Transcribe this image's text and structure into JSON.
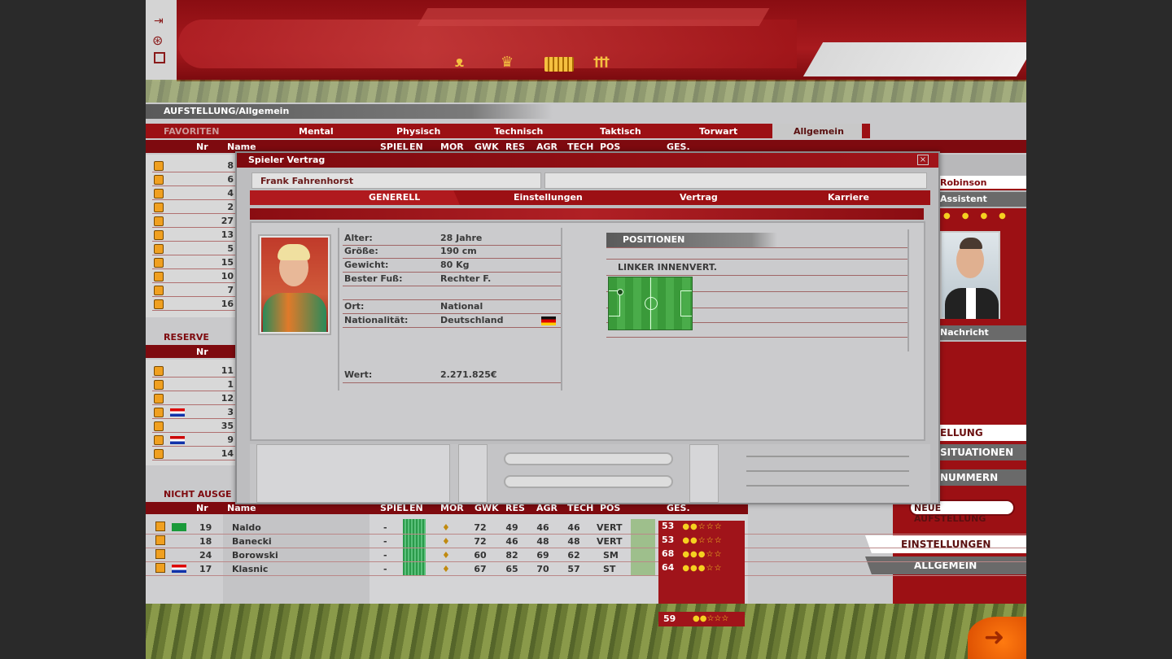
{
  "header": {
    "breadcrumb": "AUFSTELLUNG/Allgemein",
    "icons": [
      "team-icon",
      "trophy-icon",
      "stadium-icon",
      "players-icon"
    ]
  },
  "filter_tabs": {
    "favoriten": "FAVORITEN",
    "tabs": [
      "Mental",
      "Physisch",
      "Technisch",
      "Taktisch",
      "Torwart",
      "Allgemein"
    ]
  },
  "columns": {
    "nr": "Nr",
    "name": "Name",
    "headers": [
      "SPIEL",
      "EN",
      "MOR",
      "GWK",
      "RES",
      "AGR",
      "TECH",
      "POS",
      "GES."
    ]
  },
  "favoriten_numbers": [
    "8",
    "6",
    "4",
    "2",
    "27",
    "13",
    "5",
    "15",
    "10",
    "7",
    "16"
  ],
  "reserve": {
    "label": "RESERVE",
    "nr": "Nr",
    "rows": [
      "11",
      "1",
      "12",
      "3",
      "35",
      "9",
      "14"
    ]
  },
  "nicht": {
    "label": "NICHT AUSGE",
    "headers": [
      "Nr",
      "Name",
      "SPIEL",
      "EN",
      "MOR",
      "GWK",
      "RES",
      "AGR",
      "TECH",
      "POS",
      "GES."
    ],
    "rows": [
      {
        "nr": "19",
        "name": "Naldo",
        "spiel": "-",
        "gwk": "72",
        "res": "49",
        "agr": "46",
        "tech": "46",
        "pos": "VERT",
        "ges": "53"
      },
      {
        "nr": "18",
        "name": "Banecki",
        "spiel": "-",
        "gwk": "72",
        "res": "46",
        "agr": "48",
        "tech": "48",
        "pos": "VERT",
        "ges": "53"
      },
      {
        "nr": "24",
        "name": "Borowski",
        "spiel": "-",
        "gwk": "60",
        "res": "82",
        "agr": "69",
        "tech": "62",
        "pos": "SM",
        "ges": "68"
      },
      {
        "nr": "17",
        "name": "Klasnic",
        "spiel": "-",
        "gwk": "67",
        "res": "65",
        "agr": "70",
        "tech": "57",
        "pos": "ST",
        "ges": "64"
      }
    ],
    "extra_ges": "59"
  },
  "right_panel": {
    "name": "Robinson",
    "role": "Assistent",
    "nachricht": "Nachricht",
    "menu": [
      "ELLUNG",
      "SITUATIONEN",
      "NUMMERN"
    ],
    "neue": "NEUE AUFSTELLUNG",
    "einstellungen": "EINSTELLUNGEN",
    "allgemein": "ALLGEMEIN"
  },
  "dialog": {
    "title": "Spieler Vertrag",
    "player_name": "Frank Fahrenhorst",
    "tabs": [
      "GENERELL",
      "Einstellungen",
      "Vertrag",
      "Karriere"
    ],
    "fields": [
      {
        "label": "Alter:",
        "value": "28 Jahre"
      },
      {
        "label": "Größe:",
        "value": "190 cm"
      },
      {
        "label": "Gewicht:",
        "value": "80 Kg"
      },
      {
        "label": "Bester Fuß:",
        "value": "Rechter F."
      },
      {
        "label": "Ort:",
        "value": "National"
      },
      {
        "label": "Nationalität:",
        "value": "Deutschland"
      },
      {
        "label": "Wert:",
        "value": "2.271.825€"
      }
    ],
    "positions_title": "POSITIONEN",
    "position": "LINKER INNENVERT."
  },
  "colors": {
    "accent": "#9c1014",
    "panel": "#c9c9cb"
  }
}
